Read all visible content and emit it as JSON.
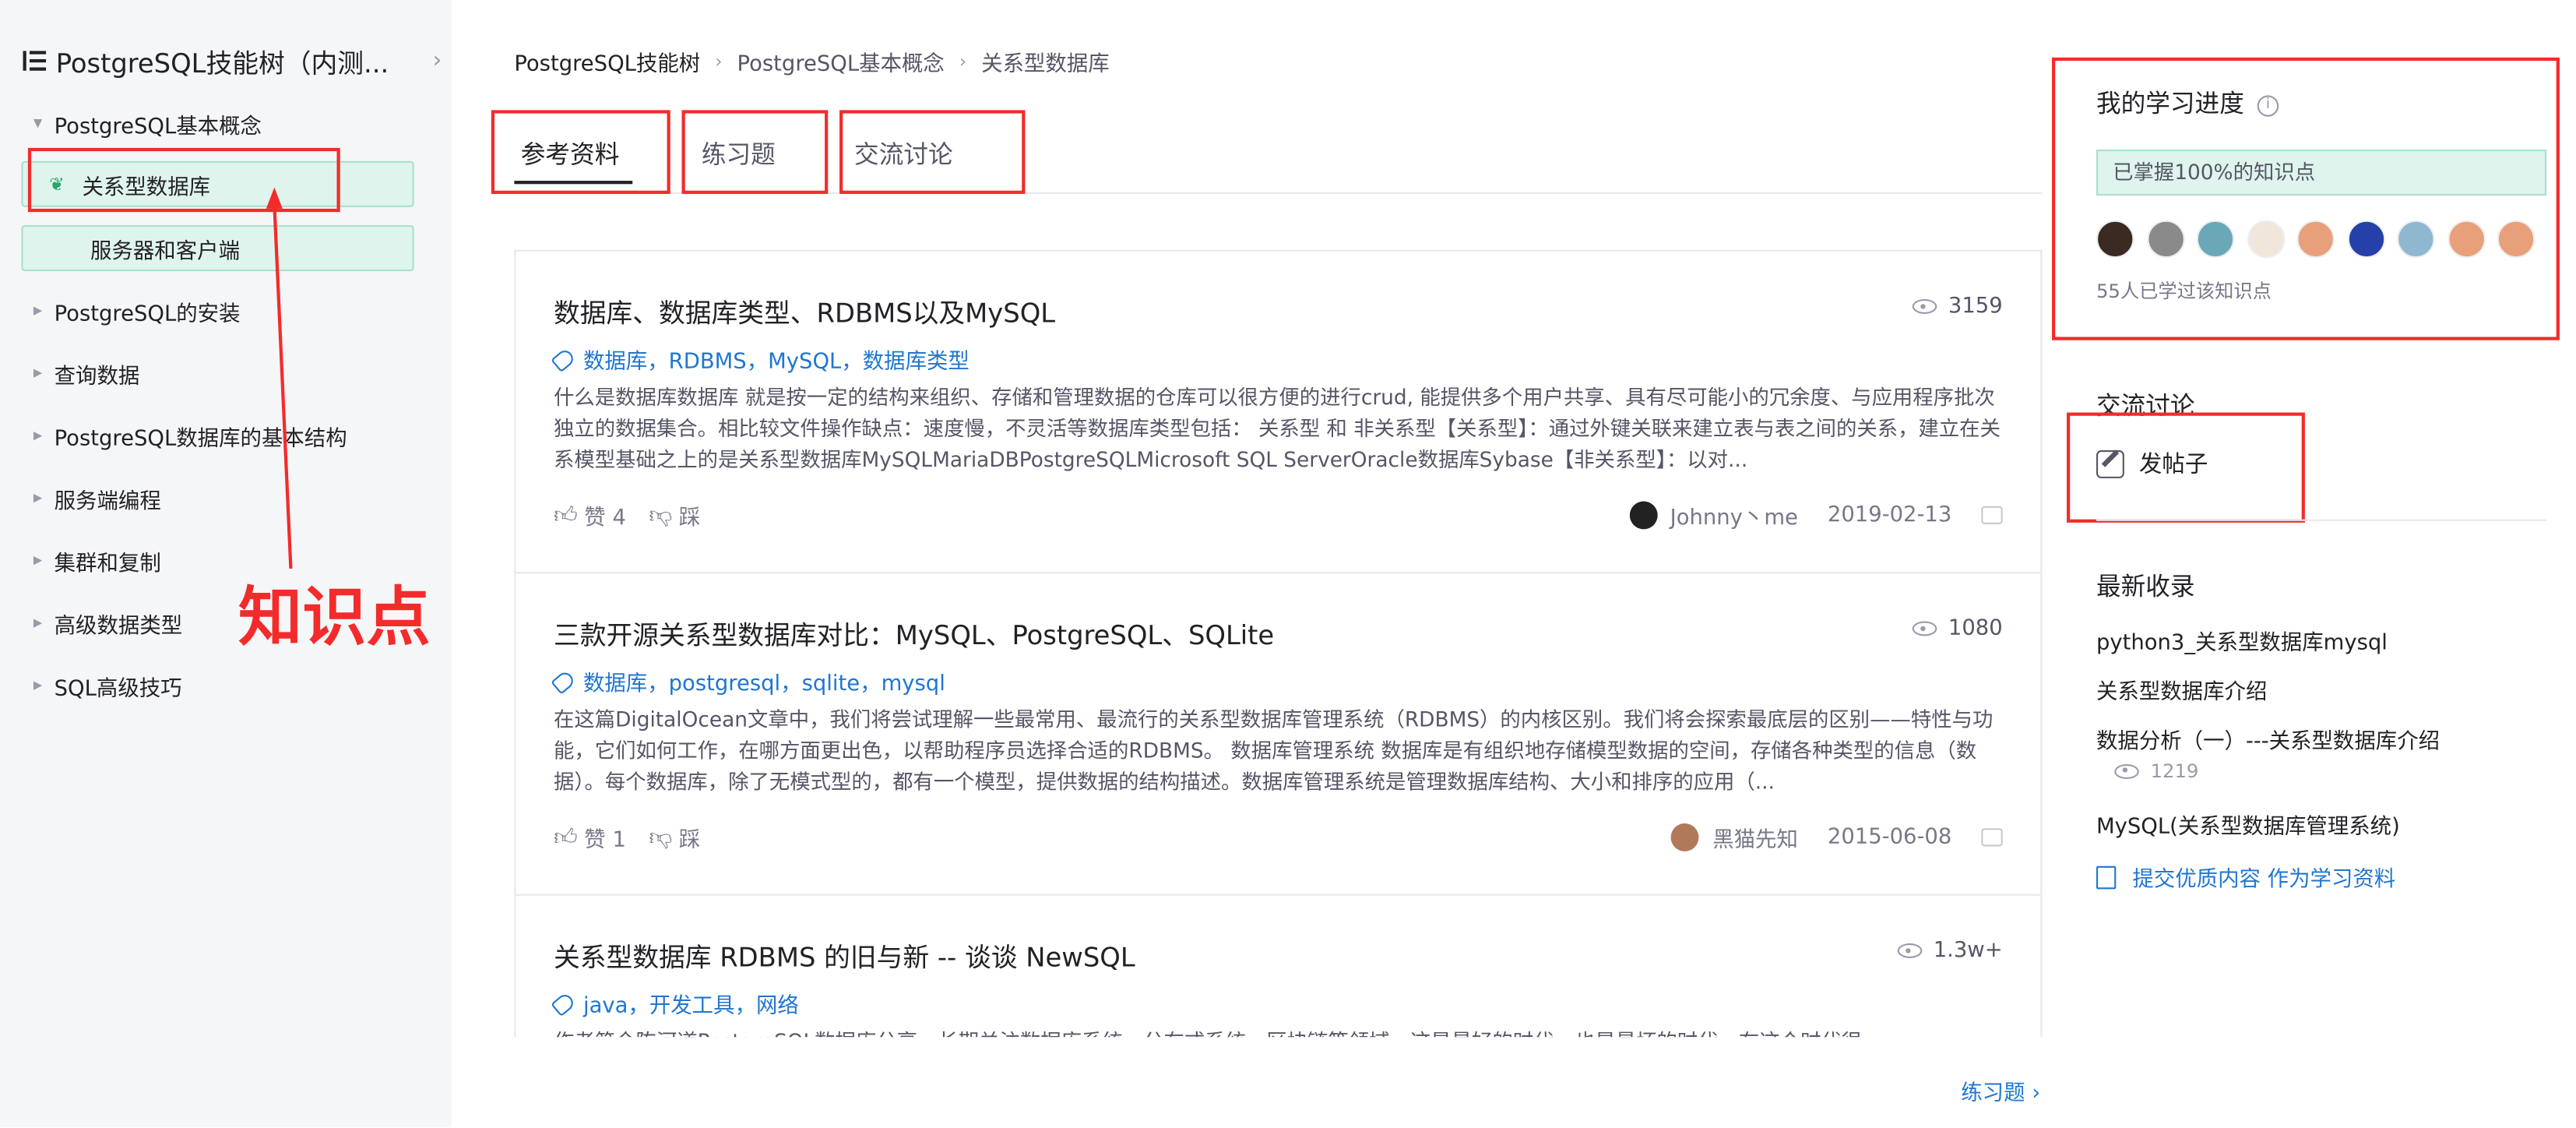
{
  "sidebar": {
    "title": "PostgreSQL技能树（内测...",
    "items": [
      {
        "label": "PostgreSQL基本概念"
      },
      {
        "label": "关系型数据库"
      },
      {
        "label": "服务器和客户端"
      },
      {
        "label": "PostgreSQL的安装"
      },
      {
        "label": "查询数据"
      },
      {
        "label": "PostgreSQL数据库的基本结构"
      },
      {
        "label": "服务端编程"
      },
      {
        "label": "集群和复制"
      },
      {
        "label": "高级数据类型"
      },
      {
        "label": "SQL高级技巧"
      }
    ]
  },
  "annotation": {
    "text": "知识点"
  },
  "breadcrumb": [
    "PostgreSQL技能树",
    "PostgreSQL基本概念",
    "关系型数据库"
  ],
  "tabs": [
    "参考资料",
    "练习题",
    "交流讨论"
  ],
  "articles": [
    {
      "title": "数据库、数据库类型、RDBMS以及MySQL",
      "views": "3159",
      "tags": "数据库，RDBMS，MySQL，数据库类型",
      "desc": "什么是数据库数据库 就是按一定的结构来组织、存储和管理数据的仓库可以很方便的进行crud, 能提供多个用户共享、具有尽可能小的冗余度、与应用程序批次独立的数据集合。相比较文件操作缺点：速度慢，不灵活等数据库类型包括： 关系型 和 非关系型【关系型】：通过外键关联来建立表与表之间的关系，建立在关系模型基础之上的是关系型数据库MySQLMariaDBPostgreSQLMicrosoft SQL ServerOracle数据库Sybase【非关系型】：以对...",
      "likes": "赞 4",
      "dislike": "踩",
      "author": "Johnny丶me",
      "date": "2019-02-13"
    },
    {
      "title": "三款开源关系型数据库对比：MySQL、PostgreSQL、SQLite",
      "views": "1080",
      "tags": "数据库，postgresql，sqlite，mysql",
      "desc": "在这篇DigitalOcean文章中，我们将尝试理解一些最常用、最流行的关系型数据库管理系统（RDBMS）的内核区别。我们将会探索最底层的区别——特性与功能，它们如何工作，在哪方面更出色，以帮助程序员选择合适的RDBMS。 数据库管理系统 数据库是有组织地存储模型数据的空间，存储各种类型的信息（数据）。每个数据库，除了无模式型的，都有一个模型，提供数据的结构描述。数据库管理系统是管理数据库结构、大小和排序的应用（...",
      "likes": "赞 1",
      "dislike": "踩",
      "author": "黑猫先知",
      "date": "2015-06-08"
    },
    {
      "title": "关系型数据库 RDBMS 的旧与新 -- 谈谈 NewSQL",
      "views": "1.3w+",
      "tags": "java，开发工具，网络",
      "desc": "作者简介陈河道PostgreSQL数据库分享，长期关注数据库系统、分布式系统、区块链等领域，这是最好的时代，也是最坏的时代，在这个时代很..."
    }
  ],
  "practice_link": "练习题 ›",
  "progress": {
    "title": "我的学习进度",
    "info_icon": "ⓘ",
    "mastered": "已掌握100%的知识点",
    "passed": "55人已学过该知识点"
  },
  "discussion": {
    "title": "交流讨论",
    "post": "发帖子"
  },
  "recent": {
    "title": "最新收录",
    "items": [
      "python3_关系型数据库mysql",
      "关系型数据库介绍",
      "数据分析（一）---关系型数据库介绍",
      "MySQL(关系型数据库管理系统)"
    ],
    "views": "1219",
    "submit": "提交优质内容 作为学习资料"
  },
  "colors": {
    "accent": "#1f76d2",
    "annotation": "#f42b2b",
    "highlight_bg": "#dff4ed",
    "highlight_border": "#a6e0cf"
  }
}
